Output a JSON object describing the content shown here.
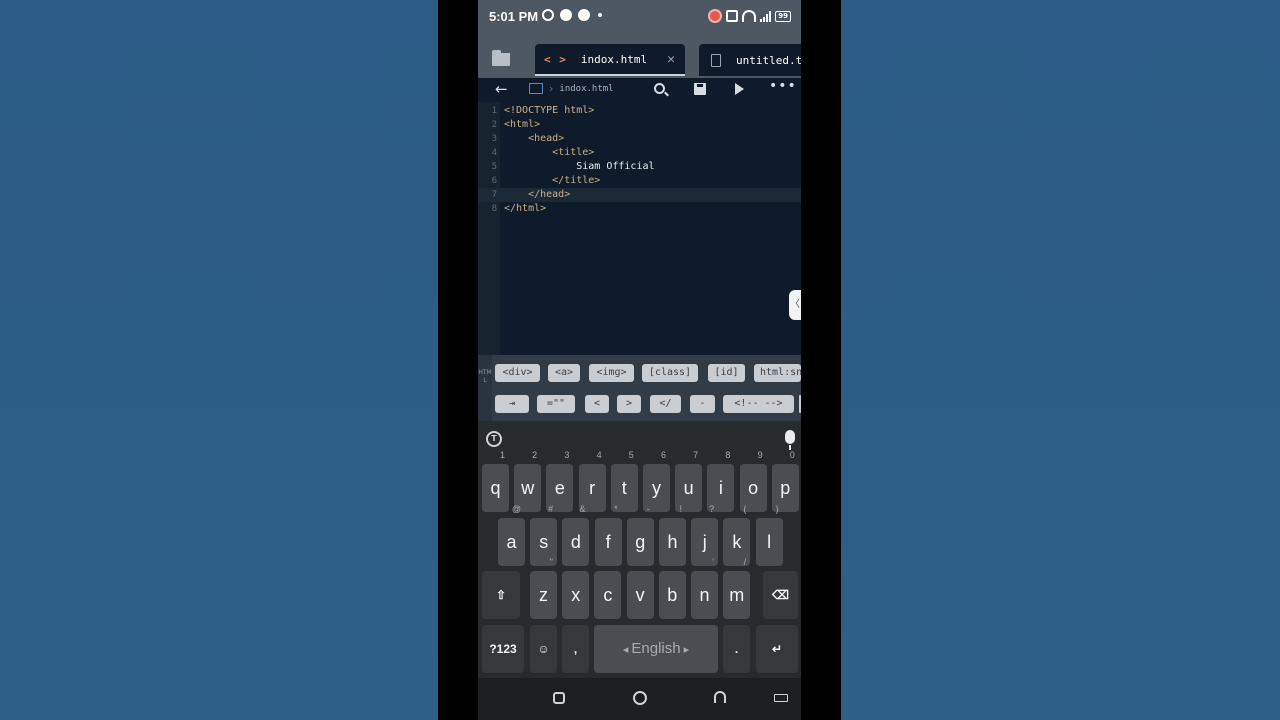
{
  "status": {
    "time": "5:01 PM",
    "battery": "99"
  },
  "tabs": [
    {
      "label": "indox.html"
    },
    {
      "label": "untitled.t"
    }
  ],
  "toolbar": {
    "breadcrumb": "indox.html"
  },
  "editor": {
    "lines": [
      {
        "num": "1",
        "text": "<!DOCTYPE html>"
      },
      {
        "num": "2",
        "text": "<html>"
      },
      {
        "num": "3",
        "text": "    <head>"
      },
      {
        "num": "4",
        "text": "        <title>"
      },
      {
        "num": "5",
        "text": "            Siam Official"
      },
      {
        "num": "6",
        "text": "        </title>"
      },
      {
        "num": "7",
        "text": "    </head>"
      },
      {
        "num": "8",
        "text": "</html>"
      }
    ]
  },
  "snippets": {
    "side_label": "HTML",
    "row1": [
      "<div>",
      "<a>",
      "<img>",
      "[class]",
      "[id]",
      "html:sn"
    ],
    "row2": [
      "⇥",
      "=\"\"",
      "<",
      ">",
      "</",
      "-",
      "<!-- -->"
    ]
  },
  "keyboard": {
    "row1": [
      {
        "k": "q",
        "h": "1"
      },
      {
        "k": "w",
        "h": "2"
      },
      {
        "k": "e",
        "h": "3"
      },
      {
        "k": "r",
        "h": "4"
      },
      {
        "k": "t",
        "h": "5"
      },
      {
        "k": "y",
        "h": "6"
      },
      {
        "k": "u",
        "h": "7"
      },
      {
        "k": "i",
        "h": "8"
      },
      {
        "k": "o",
        "h": "9"
      },
      {
        "k": "p",
        "h": "0"
      }
    ],
    "row2": [
      {
        "k": "a",
        "h": "@"
      },
      {
        "k": "s",
        "h": "#"
      },
      {
        "k": "d",
        "h": "&"
      },
      {
        "k": "f",
        "h": "*"
      },
      {
        "k": "g",
        "h": "-"
      },
      {
        "k": "h",
        "h": "!"
      },
      {
        "k": "j",
        "h": "?"
      },
      {
        "k": "k",
        "h": "("
      },
      {
        "k": "l",
        "h": ")"
      }
    ],
    "row3": [
      {
        "k": "z",
        "h": "\""
      },
      {
        "k": "x",
        "h": ""
      },
      {
        "k": "c",
        "h": ""
      },
      {
        "k": "v",
        "h": ""
      },
      {
        "k": "b",
        "h": ""
      },
      {
        "k": "n",
        "h": "'"
      },
      {
        "k": "m",
        "h": "/"
      }
    ],
    "symbols_label": "?123",
    "comma": ",",
    "space_label": "English",
    "period": ".",
    "shift": "⇧",
    "backspace": "⌫",
    "enter": "↵",
    "emoji": "☺"
  }
}
